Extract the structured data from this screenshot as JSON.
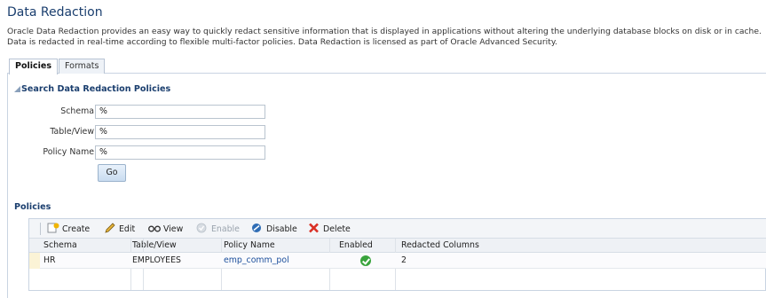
{
  "page": {
    "title": "Data Redaction",
    "description_line1": "Oracle Data Redaction provides an easy way to quickly redact sensitive information that is displayed in applications without altering the underlying database blocks on disk or in cache.",
    "description_line2": "Data is redacted in real-time according to flexible multi-factor policies. Data Redaction is licensed as part of Oracle Advanced Security."
  },
  "tabs": [
    {
      "label": "Policies",
      "active": true
    },
    {
      "label": "Formats",
      "active": false
    }
  ],
  "search": {
    "title": "Search Data Redaction Policies",
    "fields": [
      {
        "label": "Schema",
        "value": "%"
      },
      {
        "label": "Table/View",
        "value": "%"
      },
      {
        "label": "Policy Name",
        "value": "%"
      }
    ],
    "go_label": "Go"
  },
  "policies": {
    "title": "Policies",
    "toolbar": {
      "create": "Create",
      "edit": "Edit",
      "view": "View",
      "enable": "Enable",
      "disable": "Disable",
      "delete": "Delete"
    },
    "columns": [
      "Schema",
      "Table/View",
      "Policy Name",
      "Enabled",
      "Redacted Columns"
    ],
    "rows": [
      {
        "schema": "HR",
        "table": "EMPLOYEES",
        "policy": "emp_comm_pol",
        "enabled": true,
        "redacted": "2"
      }
    ]
  },
  "colors": {
    "title": "#1a3e6e",
    "link": "#1c4f9c",
    "enabled_check": "#39a33c",
    "delete_icon": "#d93025",
    "disable_icon": "#2f6db5"
  },
  "icons": [
    "create-icon",
    "edit-pencil-icon",
    "view-glasses-icon",
    "enable-icon",
    "disable-icon",
    "delete-x-icon",
    "enabled-check-icon",
    "collapse-triangle-icon"
  ]
}
